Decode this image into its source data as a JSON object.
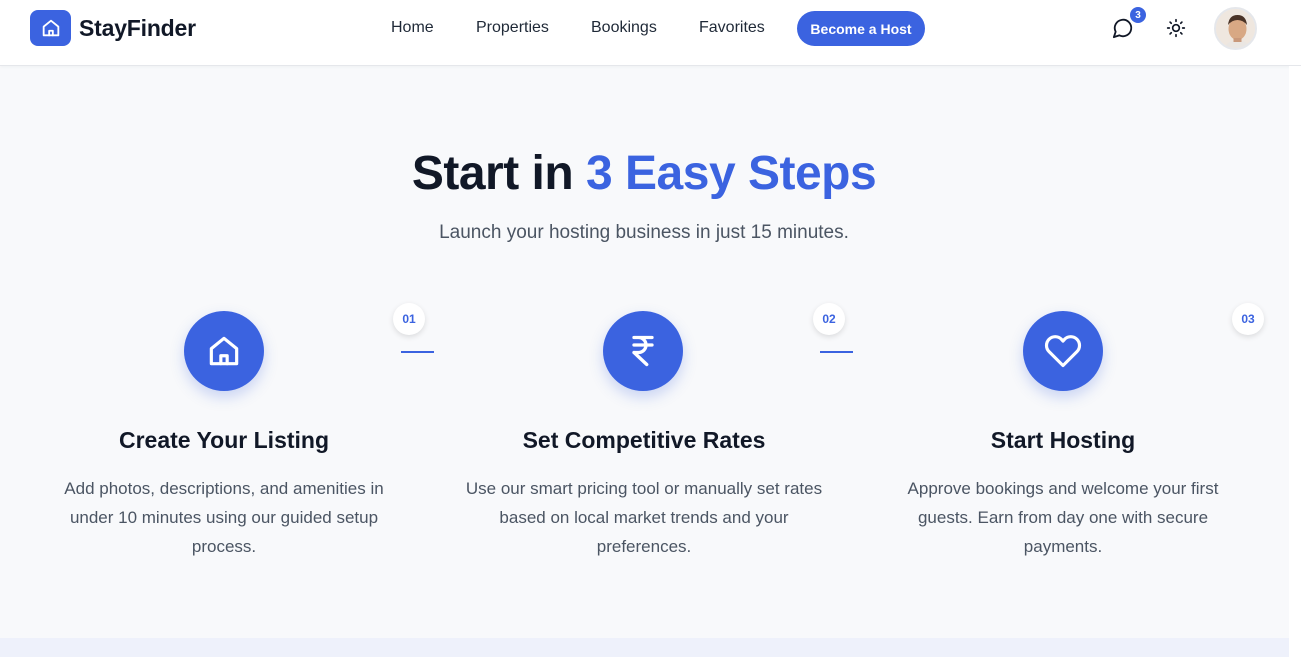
{
  "header": {
    "brand": "StayFinder",
    "nav": [
      "Home",
      "Properties",
      "Bookings",
      "Favorites"
    ],
    "cta": "Become a Host",
    "messages_badge": "3",
    "icons": {
      "logo": "home-icon",
      "messages": "chat-bubble-icon",
      "theme": "sun-icon"
    }
  },
  "hero": {
    "title_prefix": "Start in ",
    "title_accent": "3 Easy Steps",
    "subtitle": "Launch your hosting business in just 15 minutes."
  },
  "steps": [
    {
      "number": "01",
      "icon": "home-icon",
      "title": "Create Your Listing",
      "description": "Add photos, descriptions, and amenities in under 10 minutes using our guided setup process."
    },
    {
      "number": "02",
      "icon": "rupee-icon",
      "title": "Set Competitive Rates",
      "description": "Use our smart pricing tool or manually set rates based on local market trends and your preferences."
    },
    {
      "number": "03",
      "icon": "heart-icon",
      "title": "Start Hosting",
      "description": "Approve bookings and welcome your first guests. Earn from day one with secure payments."
    }
  ],
  "colors": {
    "accent": "#3b63e0",
    "heading": "#111827",
    "body_text": "#4b5563",
    "background": "#f8f9fb"
  }
}
